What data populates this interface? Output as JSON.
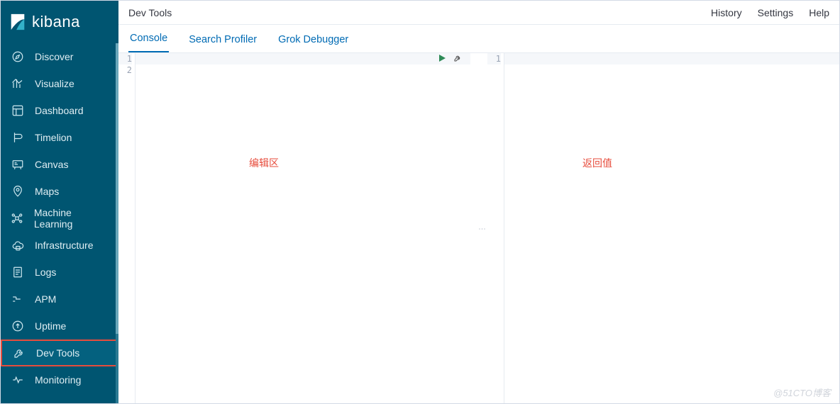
{
  "brand": {
    "name": "kibana"
  },
  "sidebar": {
    "items": [
      {
        "label": "Discover",
        "icon": "compass-icon"
      },
      {
        "label": "Visualize",
        "icon": "bar-chart-icon"
      },
      {
        "label": "Dashboard",
        "icon": "dashboard-icon"
      },
      {
        "label": "Timelion",
        "icon": "timelion-icon"
      },
      {
        "label": "Canvas",
        "icon": "canvas-icon"
      },
      {
        "label": "Maps",
        "icon": "map-pin-icon"
      },
      {
        "label": "Machine Learning",
        "icon": "ml-icon"
      },
      {
        "label": "Infrastructure",
        "icon": "cloud-icon"
      },
      {
        "label": "Logs",
        "icon": "logs-icon"
      },
      {
        "label": "APM",
        "icon": "apm-icon"
      },
      {
        "label": "Uptime",
        "icon": "uptime-icon"
      },
      {
        "label": "Dev Tools",
        "icon": "wrench-icon"
      },
      {
        "label": "Monitoring",
        "icon": "heartbeat-icon"
      }
    ],
    "highlighted_index": 11
  },
  "topbar": {
    "title": "Dev Tools",
    "links": {
      "history": "History",
      "settings": "Settings",
      "help": "Help"
    }
  },
  "tabs": [
    {
      "label": "Console",
      "active": true
    },
    {
      "label": "Search Profiler",
      "active": false
    },
    {
      "label": "Grok Debugger",
      "active": false
    }
  ],
  "console": {
    "editor": {
      "line_numbers": [
        1,
        2
      ],
      "annotation": "编辑区"
    },
    "output": {
      "line_numbers": [
        1
      ],
      "annotation": "返回值"
    },
    "actions": {
      "run": "run",
      "settings": "settings"
    }
  },
  "watermark": "@51CTO博客"
}
